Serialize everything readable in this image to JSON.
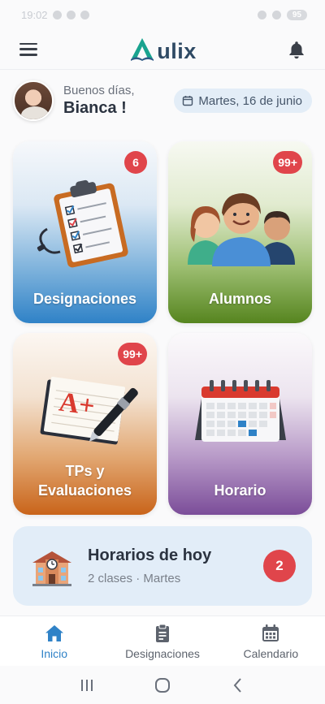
{
  "status_bar": {
    "time": "19:02",
    "battery": "95"
  },
  "header": {
    "app_name": "ulix",
    "logo_letter": "A",
    "menu_icon": "hamburger-menu-icon",
    "notification_icon": "bell-icon"
  },
  "greeting": {
    "salutation": "Buenos días,",
    "user_name": "Bianca !",
    "date": "Martes, 16 de junio",
    "date_icon": "calendar-small-icon"
  },
  "cards": [
    {
      "label": "Designaciones",
      "badge": "6",
      "icon": "clipboard-checklist-icon"
    },
    {
      "label": "Alumnos",
      "badge": "99+",
      "icon": "students-group-icon"
    },
    {
      "label_line1": "TPs y",
      "label_line2": "Evaluaciones",
      "badge": "99+",
      "icon": "graded-paper-pen-icon"
    },
    {
      "label": "Horario",
      "badge": "",
      "icon": "desk-calendar-icon"
    }
  ],
  "today": {
    "title": "Horarios de hoy",
    "subtitle": "2 clases · Martes",
    "badge": "2",
    "icon": "school-building-icon"
  },
  "bottom_nav": [
    {
      "label": "Inicio",
      "icon": "home-icon",
      "active": true
    },
    {
      "label": "Designaciones",
      "icon": "clipboard-icon",
      "active": false
    },
    {
      "label": "Calendario",
      "icon": "calendar-icon",
      "active": false
    }
  ],
  "system_nav": [
    "recents-icon",
    "home-circle-icon",
    "back-icon"
  ],
  "colors": {
    "accent": "#2f82c7",
    "badge": "#e0454b",
    "designaciones": "#2f82c7",
    "alumnos": "#56851f",
    "tps": "#c9641a",
    "horario": "#7b4d99"
  }
}
